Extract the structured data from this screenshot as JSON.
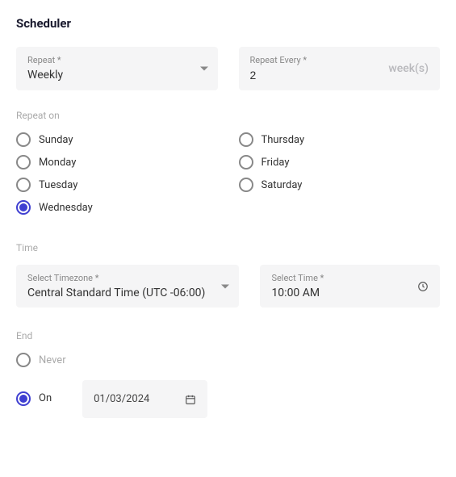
{
  "title": "Scheduler",
  "repeat": {
    "label": "Repeat *",
    "value": "Weekly"
  },
  "repeatEvery": {
    "label": "Repeat Every *",
    "value": "2",
    "unit": "week(s)"
  },
  "repeatOn": {
    "label": "Repeat on",
    "days": {
      "sunday": {
        "label": "Sunday",
        "selected": false
      },
      "monday": {
        "label": "Monday",
        "selected": false
      },
      "tuesday": {
        "label": "Tuesday",
        "selected": false
      },
      "wednesday": {
        "label": "Wednesday",
        "selected": true
      },
      "thursday": {
        "label": "Thursday",
        "selected": false
      },
      "friday": {
        "label": "Friday",
        "selected": false
      },
      "saturday": {
        "label": "Saturday",
        "selected": false
      }
    }
  },
  "time": {
    "label": "Time",
    "timezone": {
      "label": "Select Timezone *",
      "value": "Central Standard Time (UTC -06:00)"
    },
    "selectTime": {
      "label": "Select Time *",
      "value": "10:00 AM"
    }
  },
  "end": {
    "label": "End",
    "never": {
      "label": "Never",
      "selected": false
    },
    "on": {
      "label": "On",
      "selected": true,
      "date": "01/03/2024"
    }
  }
}
